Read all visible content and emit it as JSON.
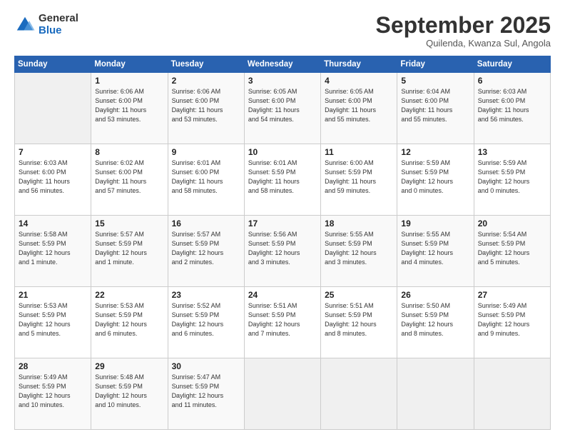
{
  "header": {
    "logo_general": "General",
    "logo_blue": "Blue",
    "month_title": "September 2025",
    "subtitle": "Quilenda, Kwanza Sul, Angola"
  },
  "weekdays": [
    "Sunday",
    "Monday",
    "Tuesday",
    "Wednesday",
    "Thursday",
    "Friday",
    "Saturday"
  ],
  "weeks": [
    [
      {
        "day": "",
        "info": ""
      },
      {
        "day": "1",
        "info": "Sunrise: 6:06 AM\nSunset: 6:00 PM\nDaylight: 11 hours\nand 53 minutes."
      },
      {
        "day": "2",
        "info": "Sunrise: 6:06 AM\nSunset: 6:00 PM\nDaylight: 11 hours\nand 53 minutes."
      },
      {
        "day": "3",
        "info": "Sunrise: 6:05 AM\nSunset: 6:00 PM\nDaylight: 11 hours\nand 54 minutes."
      },
      {
        "day": "4",
        "info": "Sunrise: 6:05 AM\nSunset: 6:00 PM\nDaylight: 11 hours\nand 55 minutes."
      },
      {
        "day": "5",
        "info": "Sunrise: 6:04 AM\nSunset: 6:00 PM\nDaylight: 11 hours\nand 55 minutes."
      },
      {
        "day": "6",
        "info": "Sunrise: 6:03 AM\nSunset: 6:00 PM\nDaylight: 11 hours\nand 56 minutes."
      }
    ],
    [
      {
        "day": "7",
        "info": "Sunrise: 6:03 AM\nSunset: 6:00 PM\nDaylight: 11 hours\nand 56 minutes."
      },
      {
        "day": "8",
        "info": "Sunrise: 6:02 AM\nSunset: 6:00 PM\nDaylight: 11 hours\nand 57 minutes."
      },
      {
        "day": "9",
        "info": "Sunrise: 6:01 AM\nSunset: 6:00 PM\nDaylight: 11 hours\nand 58 minutes."
      },
      {
        "day": "10",
        "info": "Sunrise: 6:01 AM\nSunset: 5:59 PM\nDaylight: 11 hours\nand 58 minutes."
      },
      {
        "day": "11",
        "info": "Sunrise: 6:00 AM\nSunset: 5:59 PM\nDaylight: 11 hours\nand 59 minutes."
      },
      {
        "day": "12",
        "info": "Sunrise: 5:59 AM\nSunset: 5:59 PM\nDaylight: 12 hours\nand 0 minutes."
      },
      {
        "day": "13",
        "info": "Sunrise: 5:59 AM\nSunset: 5:59 PM\nDaylight: 12 hours\nand 0 minutes."
      }
    ],
    [
      {
        "day": "14",
        "info": "Sunrise: 5:58 AM\nSunset: 5:59 PM\nDaylight: 12 hours\nand 1 minute."
      },
      {
        "day": "15",
        "info": "Sunrise: 5:57 AM\nSunset: 5:59 PM\nDaylight: 12 hours\nand 1 minute."
      },
      {
        "day": "16",
        "info": "Sunrise: 5:57 AM\nSunset: 5:59 PM\nDaylight: 12 hours\nand 2 minutes."
      },
      {
        "day": "17",
        "info": "Sunrise: 5:56 AM\nSunset: 5:59 PM\nDaylight: 12 hours\nand 3 minutes."
      },
      {
        "day": "18",
        "info": "Sunrise: 5:55 AM\nSunset: 5:59 PM\nDaylight: 12 hours\nand 3 minutes."
      },
      {
        "day": "19",
        "info": "Sunrise: 5:55 AM\nSunset: 5:59 PM\nDaylight: 12 hours\nand 4 minutes."
      },
      {
        "day": "20",
        "info": "Sunrise: 5:54 AM\nSunset: 5:59 PM\nDaylight: 12 hours\nand 5 minutes."
      }
    ],
    [
      {
        "day": "21",
        "info": "Sunrise: 5:53 AM\nSunset: 5:59 PM\nDaylight: 12 hours\nand 5 minutes."
      },
      {
        "day": "22",
        "info": "Sunrise: 5:53 AM\nSunset: 5:59 PM\nDaylight: 12 hours\nand 6 minutes."
      },
      {
        "day": "23",
        "info": "Sunrise: 5:52 AM\nSunset: 5:59 PM\nDaylight: 12 hours\nand 6 minutes."
      },
      {
        "day": "24",
        "info": "Sunrise: 5:51 AM\nSunset: 5:59 PM\nDaylight: 12 hours\nand 7 minutes."
      },
      {
        "day": "25",
        "info": "Sunrise: 5:51 AM\nSunset: 5:59 PM\nDaylight: 12 hours\nand 8 minutes."
      },
      {
        "day": "26",
        "info": "Sunrise: 5:50 AM\nSunset: 5:59 PM\nDaylight: 12 hours\nand 8 minutes."
      },
      {
        "day": "27",
        "info": "Sunrise: 5:49 AM\nSunset: 5:59 PM\nDaylight: 12 hours\nand 9 minutes."
      }
    ],
    [
      {
        "day": "28",
        "info": "Sunrise: 5:49 AM\nSunset: 5:59 PM\nDaylight: 12 hours\nand 10 minutes."
      },
      {
        "day": "29",
        "info": "Sunrise: 5:48 AM\nSunset: 5:59 PM\nDaylight: 12 hours\nand 10 minutes."
      },
      {
        "day": "30",
        "info": "Sunrise: 5:47 AM\nSunset: 5:59 PM\nDaylight: 12 hours\nand 11 minutes."
      },
      {
        "day": "",
        "info": ""
      },
      {
        "day": "",
        "info": ""
      },
      {
        "day": "",
        "info": ""
      },
      {
        "day": "",
        "info": ""
      }
    ]
  ]
}
